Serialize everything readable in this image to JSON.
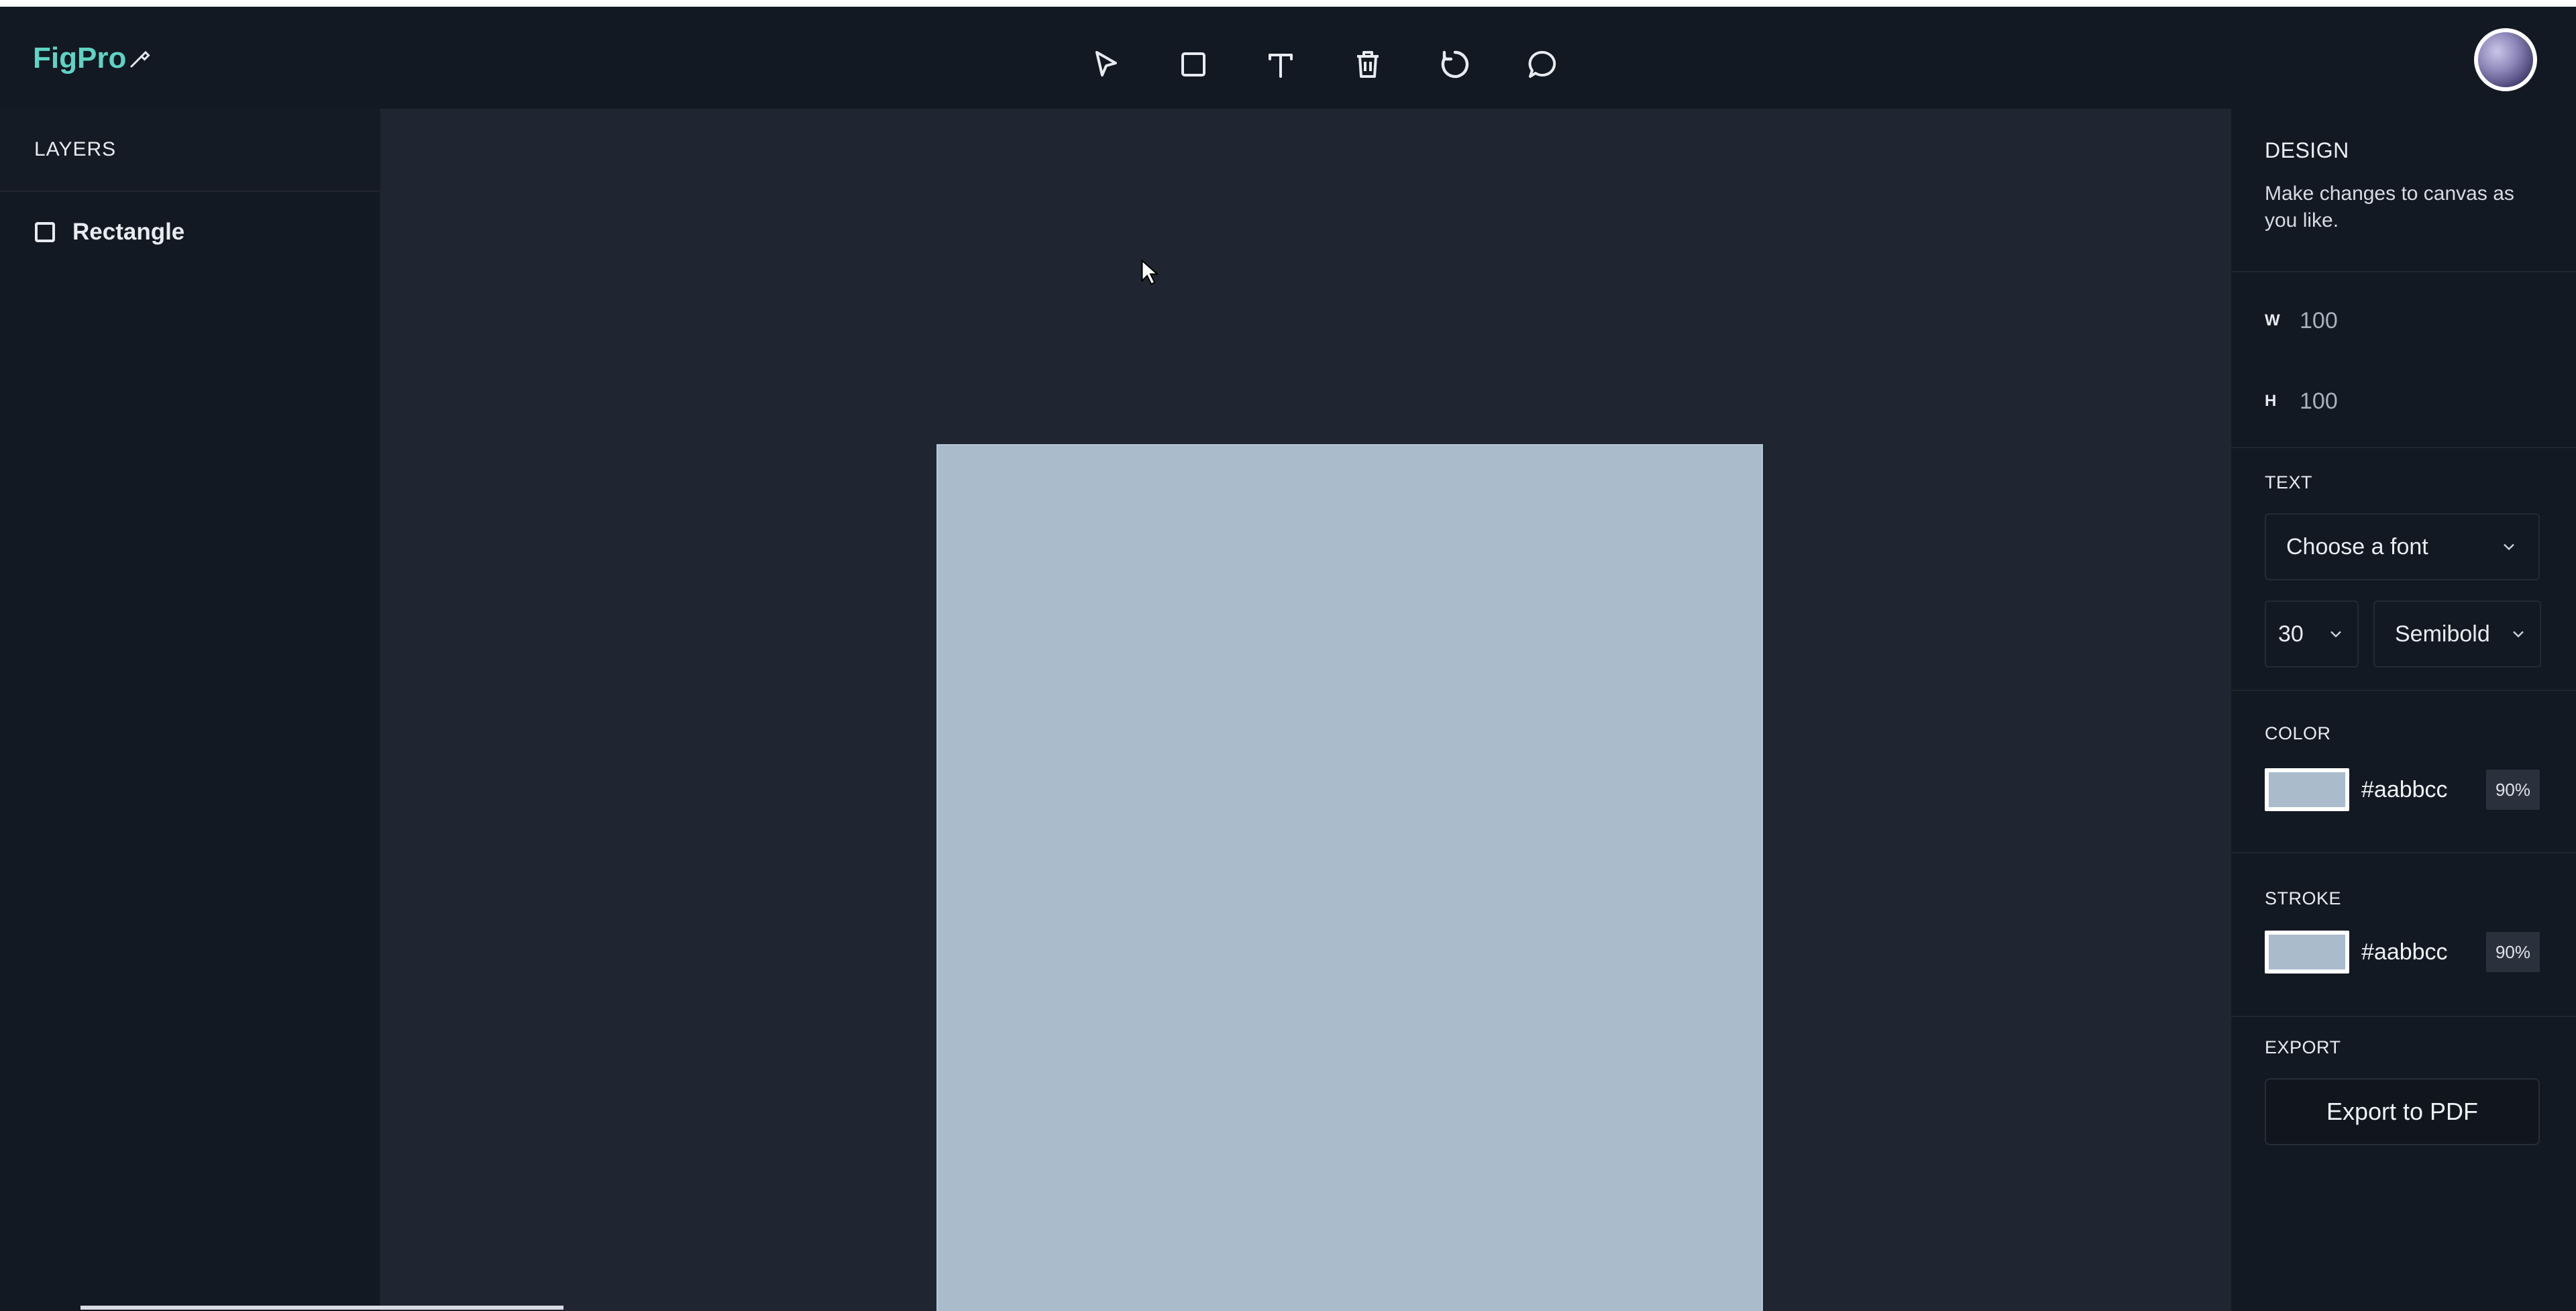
{
  "header": {
    "logo_text": "FigPro",
    "tools": [
      {
        "name": "select-tool",
        "icon": "cursor-arrow-icon"
      },
      {
        "name": "rectangle-tool",
        "icon": "square-icon"
      },
      {
        "name": "text-tool",
        "icon": "text-t-icon"
      },
      {
        "name": "delete-tool",
        "icon": "trash-icon"
      },
      {
        "name": "reset-tool",
        "icon": "rotate-icon"
      },
      {
        "name": "comment-tool",
        "icon": "chat-bubble-icon"
      }
    ]
  },
  "layers": {
    "title": "LAYERS",
    "items": [
      {
        "label": "Rectangle",
        "icon": "square-outline-icon"
      }
    ]
  },
  "canvas": {
    "shape_fill": "#aabbcc",
    "background": "#202631"
  },
  "design": {
    "title": "DESIGN",
    "description": "Make changes to canvas as you like.",
    "width_label": "W",
    "width_value": "100",
    "height_label": "H",
    "height_value": "100",
    "text_title": "TEXT",
    "font_placeholder": "Choose a font",
    "font_size": "30",
    "font_weight": "Semibold",
    "color_title": "COLOR",
    "color_hex": "#aabbcc",
    "color_opacity": "90%",
    "stroke_title": "STROKE",
    "stroke_hex": "#aabbcc",
    "stroke_opacity": "90%",
    "export_title": "EXPORT",
    "export_button": "Export to PDF"
  },
  "colors": {
    "brand": "#5fd3c4",
    "panel": "#131922",
    "canvas": "#202631",
    "shape": "#aabbcc"
  }
}
